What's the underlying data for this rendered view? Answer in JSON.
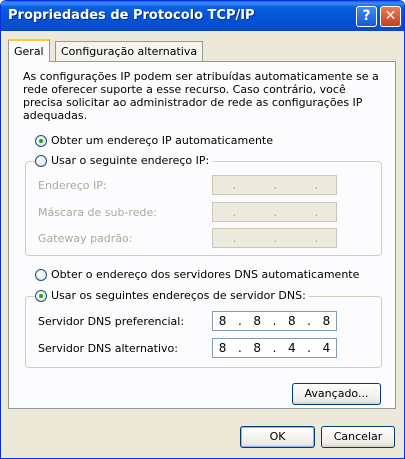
{
  "window": {
    "title": "Propriedades de Protocolo TCP/IP",
    "help_label": "?",
    "close_label": "✕"
  },
  "tabs": [
    {
      "label": "Geral"
    },
    {
      "label": "Configuração alternativa"
    }
  ],
  "intro_text": "As configurações IP podem ser atribuídas automaticamente se a rede oferecer suporte a esse recurso. Caso contrário, você precisa solicitar ao administrador de rede as configurações IP adequadas.",
  "ip_section": {
    "auto_label": "Obter um endereço IP automaticamente",
    "manual_label": "Usar o seguinte endereço IP:",
    "selected": "auto",
    "fields": [
      {
        "label": "Endereço IP:",
        "value": [
          ".",
          ".",
          "."
        ]
      },
      {
        "label": "Máscara de sub-rede:",
        "value": [
          ".",
          ".",
          "."
        ]
      },
      {
        "label": "Gateway padrão:",
        "value": [
          ".",
          ".",
          "."
        ]
      }
    ]
  },
  "dns_section": {
    "auto_label": "Obter o endereço dos servidores DNS automaticamente",
    "manual_label": "Usar os seguintes endereços de servidor DNS:",
    "selected": "manual",
    "preferred": {
      "label": "Servidor DNS preferencial:",
      "octets": [
        "8",
        "8",
        "8",
        "8"
      ]
    },
    "alternate": {
      "label": "Servidor DNS alternativo:",
      "octets": [
        "8",
        "8",
        "4",
        "4"
      ]
    }
  },
  "buttons": {
    "advanced": "Avançado...",
    "ok": "OK",
    "cancel": "Cancelar"
  }
}
